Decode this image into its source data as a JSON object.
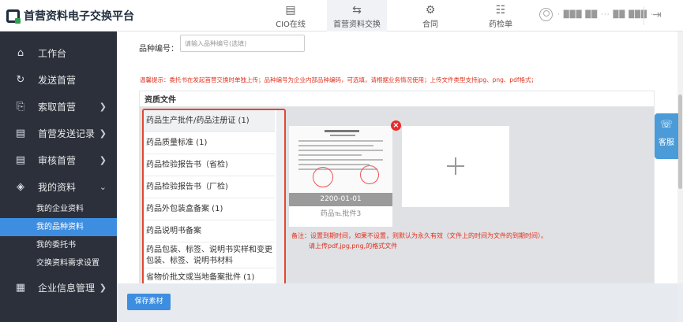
{
  "header": {
    "logo_text": "首营资料电子交换平台",
    "nav": [
      {
        "label": "CIO在线",
        "icon": "cio-online-icon"
      },
      {
        "label": "首营资料交换",
        "icon": "exchange-icon"
      },
      {
        "label": "合同",
        "icon": "contract-icon"
      },
      {
        "label": "药检单",
        "icon": "drug-inspection-icon"
      }
    ],
    "active_nav": "首营资料交换",
    "user_name": "· ███ ██ ··· ██ ███ ·",
    "logout_icon": "logout-icon"
  },
  "sidebar": {
    "items": [
      {
        "label": "工作台",
        "icon": "home-icon"
      },
      {
        "label": "发送首营",
        "icon": "send-icon"
      },
      {
        "label": "索取首营",
        "icon": "request-icon"
      },
      {
        "label": "首营发送记录",
        "icon": "record-icon"
      },
      {
        "label": "审核首营",
        "icon": "audit-icon"
      },
      {
        "label": "我的资料",
        "icon": "layers-icon"
      },
      {
        "label": "企业信息管理",
        "icon": "company-icon"
      }
    ],
    "sub_items": [
      {
        "label": "我的企业资料"
      },
      {
        "label": "我的品种资料"
      },
      {
        "label": "我的委托书"
      },
      {
        "label": "交换资料需求设置"
      }
    ],
    "active_sub": "我的品种资料"
  },
  "form": {
    "variety_code_label": "品种编号：",
    "variety_code_placeholder": "请输入品种编号(选填)",
    "variety_code_value": "",
    "tip": "温馨提示：委托书在发起首营交换时单独上传；品种编号为企业内部品种编码，可选填，请根据业务情况使用；上传文件类型支持jpg、png、pdf格式；"
  },
  "documents": {
    "section_title": "资质文件",
    "items": [
      "药品生产批件/药品注册证 (1)",
      "药品质量标准 (1)",
      "药品检验报告书（省检)",
      "药品检验报告书（厂检)",
      "药品外包装盒备案 (1)",
      "药品说明书备案",
      "药品包装、标签、说明书实样和变更包装、标签、说明书材料",
      "省物价批文或当地备案批件 (1)"
    ],
    "active_index": 0
  },
  "upload": {
    "thumbnail_date": "2200-01-01",
    "thumbnail_name": "药品℡批件3",
    "delete_icon": "close-icon",
    "add_icon": "plus-icon",
    "note_line1": "备注：设置到期时间，如果不设置，则默认为永久有效（文件上的时间为文件的到期时间）。",
    "note_line2": "请上传pdf,jpg,png,的格式文件"
  },
  "service": {
    "label": "客服",
    "icon": "headset-icon"
  },
  "footer": {
    "save_label": "保存素材"
  },
  "colors": {
    "accent": "#3d8ee0",
    "sidebar_bg": "#2b303b",
    "warning_red": "#e0311d",
    "highlight_border": "#e2472f"
  }
}
